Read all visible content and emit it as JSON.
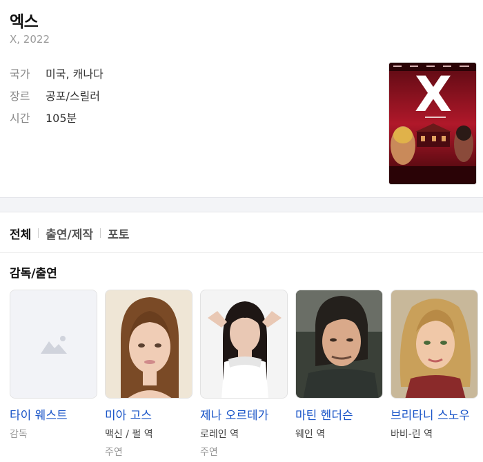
{
  "movie": {
    "title": "엑스",
    "subtitle": "X, 2022",
    "info": [
      {
        "key": "국가",
        "value": "미국, 캐나다"
      },
      {
        "key": "장르",
        "value": "공포/스릴러"
      },
      {
        "key": "시간",
        "value": "105분"
      }
    ],
    "poster_letter": "X"
  },
  "tabs": [
    {
      "label": "전체",
      "active": true
    },
    {
      "label": "출연/제작",
      "active": false
    },
    {
      "label": "포토",
      "active": false
    }
  ],
  "section": {
    "title": "감독/출연"
  },
  "cast": [
    {
      "name": "타이 웨스트",
      "role": "감독",
      "type": ""
    },
    {
      "name": "미아 고스",
      "role": "맥신 / 펄 역",
      "type": "주연"
    },
    {
      "name": "제나 오르테가",
      "role": "로레인 역",
      "type": "주연"
    },
    {
      "name": "마틴 헨더슨",
      "role": "웨인 역",
      "type": ""
    },
    {
      "name": "브리타니 스노우",
      "role": "바비-린 역",
      "type": ""
    }
  ],
  "colors": {
    "link": "#1a55c8",
    "poster_red": "#b0182a"
  }
}
